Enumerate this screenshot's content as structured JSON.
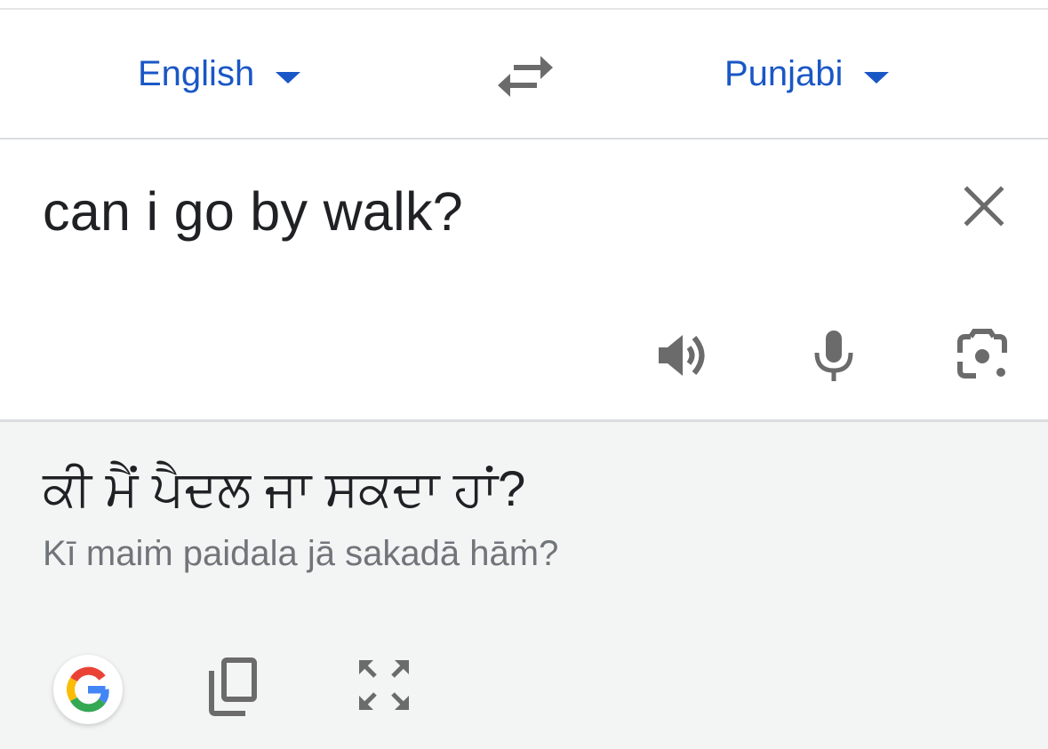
{
  "language_bar": {
    "source_language": "English",
    "target_language": "Punjabi",
    "swap_icon": "swap-arrows-icon"
  },
  "input": {
    "text": "can i go by walk?",
    "clear_icon": "close-icon",
    "actions": [
      "speaker-icon",
      "microphone-icon",
      "camera-lens-icon"
    ]
  },
  "result": {
    "translation": "ਕੀ ਮੈਂ ਪੈਦਲ ਜਾ ਸਕਦਾ ਹਾਂ?",
    "transliteration": "Kī maiṁ paidala jā sakadā hāṁ?",
    "actions": [
      "google-logo-icon",
      "copy-icon",
      "fullscreen-icon"
    ]
  },
  "colors": {
    "accent": "#1a57c6",
    "icon": "#6b6b6b",
    "text": "#202124",
    "secondary_text": "#70757a",
    "result_bg": "#f3f4f4"
  }
}
